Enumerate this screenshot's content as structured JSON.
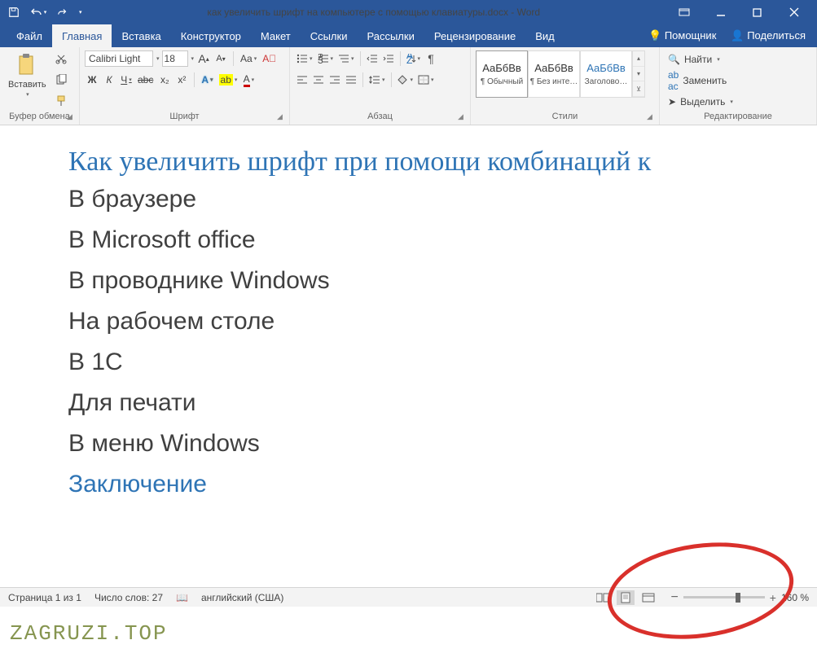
{
  "titlebar": {
    "doc_title": "как увеличить шрифт на компьютере с помощью клавиатуры.docx",
    "app_name": "Word",
    "sep": "  -  "
  },
  "tabs": {
    "file": "Файл",
    "home": "Главная",
    "insert": "Вставка",
    "design": "Конструктор",
    "layout": "Макет",
    "references": "Ссылки",
    "mailings": "Рассылки",
    "review": "Рецензирование",
    "view": "Вид",
    "tell_me": "Помощник",
    "share": "Поделиться"
  },
  "ribbon": {
    "clipboard": {
      "label": "Буфер обмена",
      "paste": "Вставить"
    },
    "font": {
      "label": "Шрифт",
      "name": "Calibri Light",
      "size": "18",
      "bold": "Ж",
      "italic": "К",
      "underline": "Ч",
      "strike": "abc",
      "sub": "x₂",
      "sup": "x²",
      "grow": "A",
      "shrink": "A",
      "case": "Aa",
      "clear": "⌫",
      "texteffects": "A",
      "highlight": "ab",
      "color": "A"
    },
    "paragraph": {
      "label": "Абзац"
    },
    "styles": {
      "label": "Стили",
      "items": [
        {
          "preview": "АаБбВв",
          "name": "¶ Обычный",
          "blue": false
        },
        {
          "preview": "АаБбВв",
          "name": "¶ Без инте…",
          "blue": false
        },
        {
          "preview": "АаБбВв",
          "name": "Заголово…",
          "blue": true
        }
      ]
    },
    "editing": {
      "label": "Редактирование",
      "find": "Найти",
      "replace": "Заменить",
      "select": "Выделить"
    }
  },
  "document": {
    "title": "Как увеличить шрифт при помощи комбинаций к",
    "h": [
      "В браузере",
      "В Microsoft office",
      "В проводнике Windows",
      "На рабочем столе",
      "В 1С",
      "Для печати",
      "В меню Windows"
    ],
    "conclusion": "Заключение"
  },
  "statusbar": {
    "page": "Страница 1 из 1",
    "words": "Число слов: 27",
    "lang": "английский (США)",
    "zoom": "160 %"
  },
  "watermark": "ZAGRUZI.TOP"
}
